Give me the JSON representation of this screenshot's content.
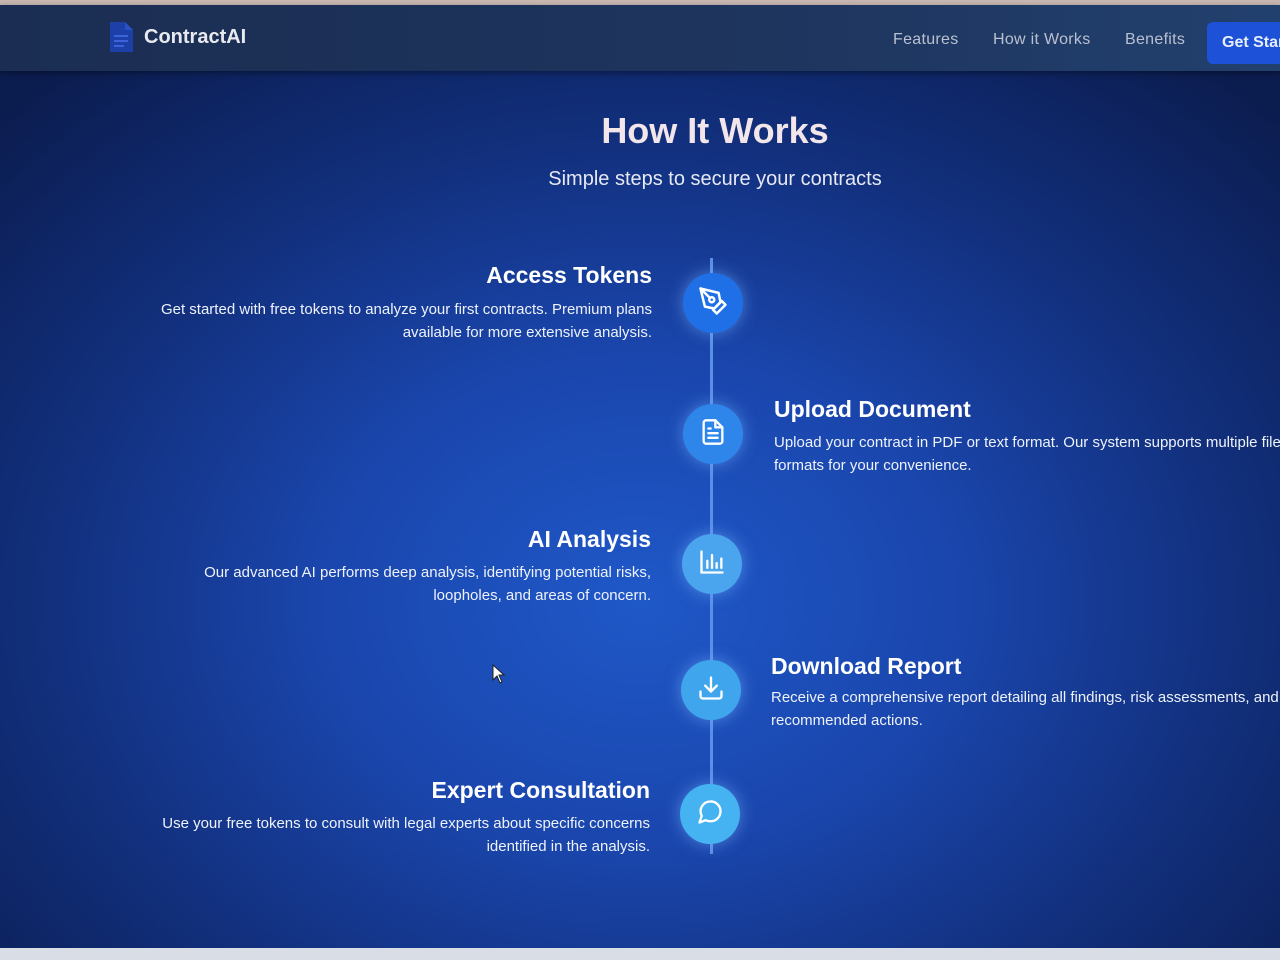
{
  "app": {
    "name": "ContractAI"
  },
  "nav": {
    "links": [
      "Features",
      "How it Works",
      "Benefits"
    ],
    "cta": "Get Started"
  },
  "section": {
    "title": "How It Works",
    "subtitle": "Simple steps to secure your contracts"
  },
  "steps": [
    {
      "title": "Access Tokens",
      "description_lines": [
        "Get started with free tokens to analyze your first contracts. Premium plans",
        "available for more extensive analysis."
      ],
      "icon": "pen-nib-icon",
      "side": "left",
      "color": "#1f6fe6"
    },
    {
      "title": "Upload Document",
      "description_lines": [
        "Upload your contract in PDF or text format. Our system supports multiple file",
        "formats for your convenience."
      ],
      "icon": "document-icon",
      "side": "right",
      "color": "#2f86ea"
    },
    {
      "title": "AI Analysis",
      "description_lines": [
        "Our advanced AI performs deep analysis, identifying potential risks,",
        "loopholes, and areas of concern."
      ],
      "icon": "bar-chart-icon",
      "side": "left",
      "color": "#4aa4ee"
    },
    {
      "title": "Download Report",
      "description_lines": [
        "Receive a comprehensive report detailing all findings, risk assessments, and",
        "recommended actions."
      ],
      "icon": "download-icon",
      "side": "right",
      "color": "#3fa6ee"
    },
    {
      "title": "Expert Consultation",
      "description_lines": [
        "Use your free tokens to consult with legal experts about specific concerns",
        "identified in the analysis."
      ],
      "icon": "chat-bubble-icon",
      "side": "left",
      "color": "#45b3f1"
    }
  ]
}
